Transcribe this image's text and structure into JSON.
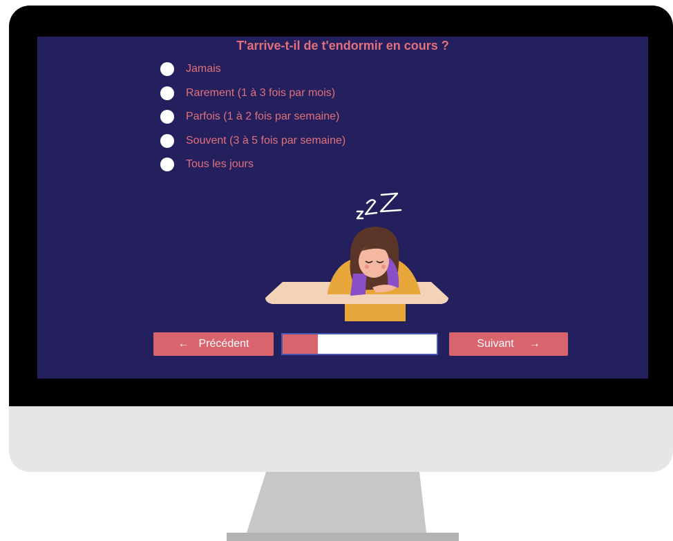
{
  "survey": {
    "question": "T'arrive-t-il de t'endormir en cours ?",
    "options": [
      {
        "label": "Jamais"
      },
      {
        "label": "Rarement (1 à 3 fois par mois)"
      },
      {
        "label": "Parfois (1 à 2 fois par semaine)"
      },
      {
        "label": "Souvent (3 à 5 fois par semaine)"
      },
      {
        "label": "Tous les jours"
      }
    ]
  },
  "illustration": {
    "zzz_text": "zZZ",
    "icon": "sleeping-student-icon"
  },
  "navigation": {
    "prev_label": "Précédent",
    "prev_icon": "arrow-left-icon",
    "next_label": "Suivant",
    "next_icon": "arrow-right-icon"
  },
  "progress": {
    "fraction": 0.23
  },
  "colors": {
    "screen_bg": "#24205e",
    "accent": "#d9646e",
    "text": "#e0707c"
  }
}
